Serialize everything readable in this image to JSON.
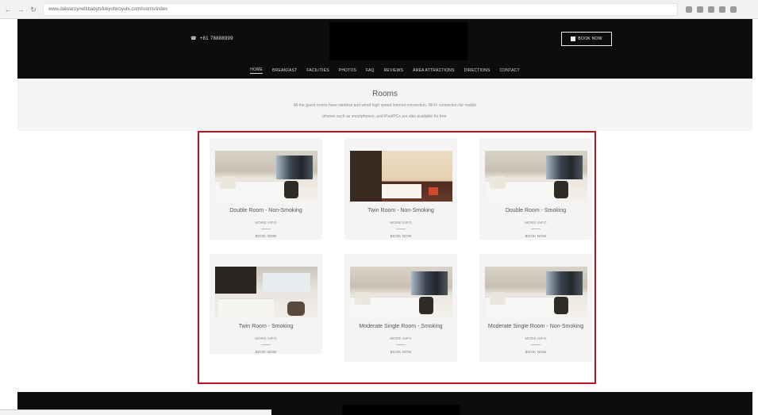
{
  "browser": {
    "url": "www.daiwaroynetkbabytsfukyohiroyuhi.com/rooms/index",
    "status_text": "",
    "icons": [
      "back-icon",
      "forward-icon",
      "reload-icon",
      "home-icon"
    ]
  },
  "header": {
    "phone": "+81 78888999",
    "book_label": "BOOK NOW"
  },
  "nav": {
    "items": [
      "HOME",
      "BREAKFAST",
      "FACILITIES",
      "PHOTOS",
      "FAQ",
      "REVIEWS",
      "AREA ATTRACTIONS",
      "DIRECTIONS",
      "CONTACT"
    ]
  },
  "intro": {
    "title": "Rooms",
    "line1": "All the guest rooms have wireless and wired high speed internet connection. Wi-Fi connection for mobile",
    "line2": "phones such as smartphones, and iPad/PCs are also available for free."
  },
  "rooms": [
    {
      "title": "Double Room - Non-Smoking",
      "rate": "MORE INFO",
      "book": "BOOK NOW",
      "image": "double-room-photo"
    },
    {
      "title": "Twin Room - Non-Smoking",
      "rate": "MORE INFO",
      "book": "BOOK NOW",
      "image": "twin-room-photo"
    },
    {
      "title": "Double Room - Smoking",
      "rate": "MORE INFO",
      "book": "BOOK NOW",
      "image": "double-room-photo"
    },
    {
      "title": "Twin Room - Smoking",
      "rate": "MORE INFO",
      "book": "BOOK NOW",
      "image": "twin-room-smoking-photo"
    },
    {
      "title": "Moderate Single Room - Smoking",
      "rate": "MORE INFO",
      "book": "BOOK NOW",
      "image": "single-room-photo"
    },
    {
      "title": "Moderate Single Room - Non-Smoking",
      "rate": "MORE INFO",
      "book": "BOOK NOW",
      "image": "single-room-photo"
    }
  ],
  "colors": {
    "header_bg": "#0d0d0d",
    "highlight": "#c1121f",
    "card_bg": "#f4f4f4"
  }
}
